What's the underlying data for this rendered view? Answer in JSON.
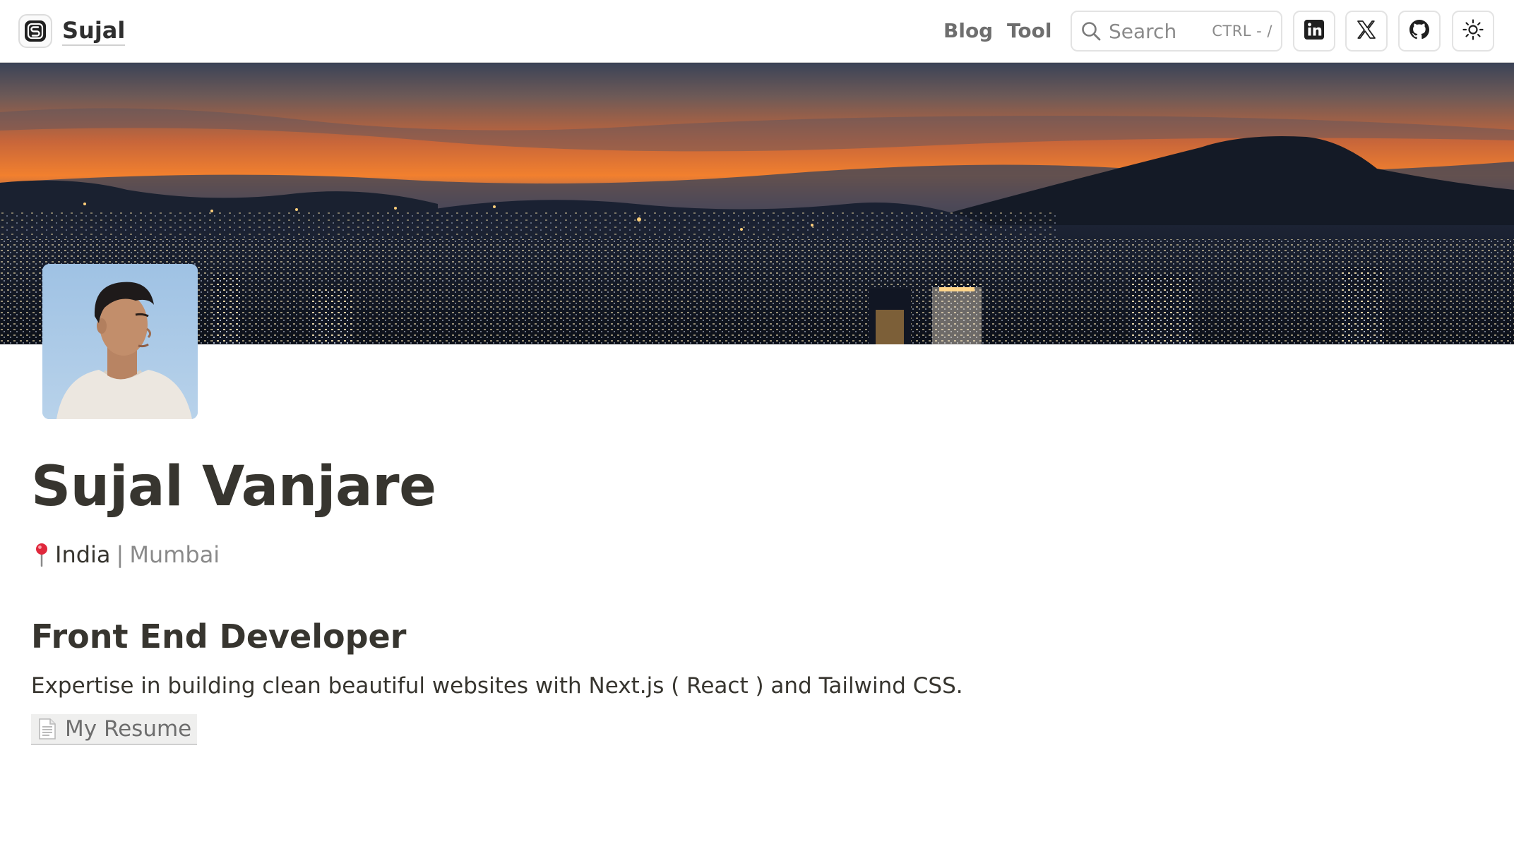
{
  "header": {
    "brand_name": "Sujal",
    "nav": [
      {
        "label": "Blog"
      },
      {
        "label": "Tool"
      }
    ],
    "search": {
      "placeholder": "Search",
      "shortcut": "CTRL - /"
    },
    "icons": [
      "linkedin-icon",
      "x-icon",
      "github-icon",
      "sun-icon"
    ]
  },
  "profile": {
    "name": "Sujal Vanjare",
    "location": {
      "country": "India",
      "separator": "|",
      "city": "Mumbai"
    },
    "role": "Front End Developer",
    "description": "Expertise in building clean beautiful websites with Next.js ( React ) and Tailwind CSS.",
    "resume_label": "My Resume"
  },
  "colors": {
    "text": "#37352f",
    "muted": "#8a8a8a",
    "sky_top": "#3a4358",
    "sky_glow": "#f07a2c",
    "pin": "#e0283c"
  }
}
